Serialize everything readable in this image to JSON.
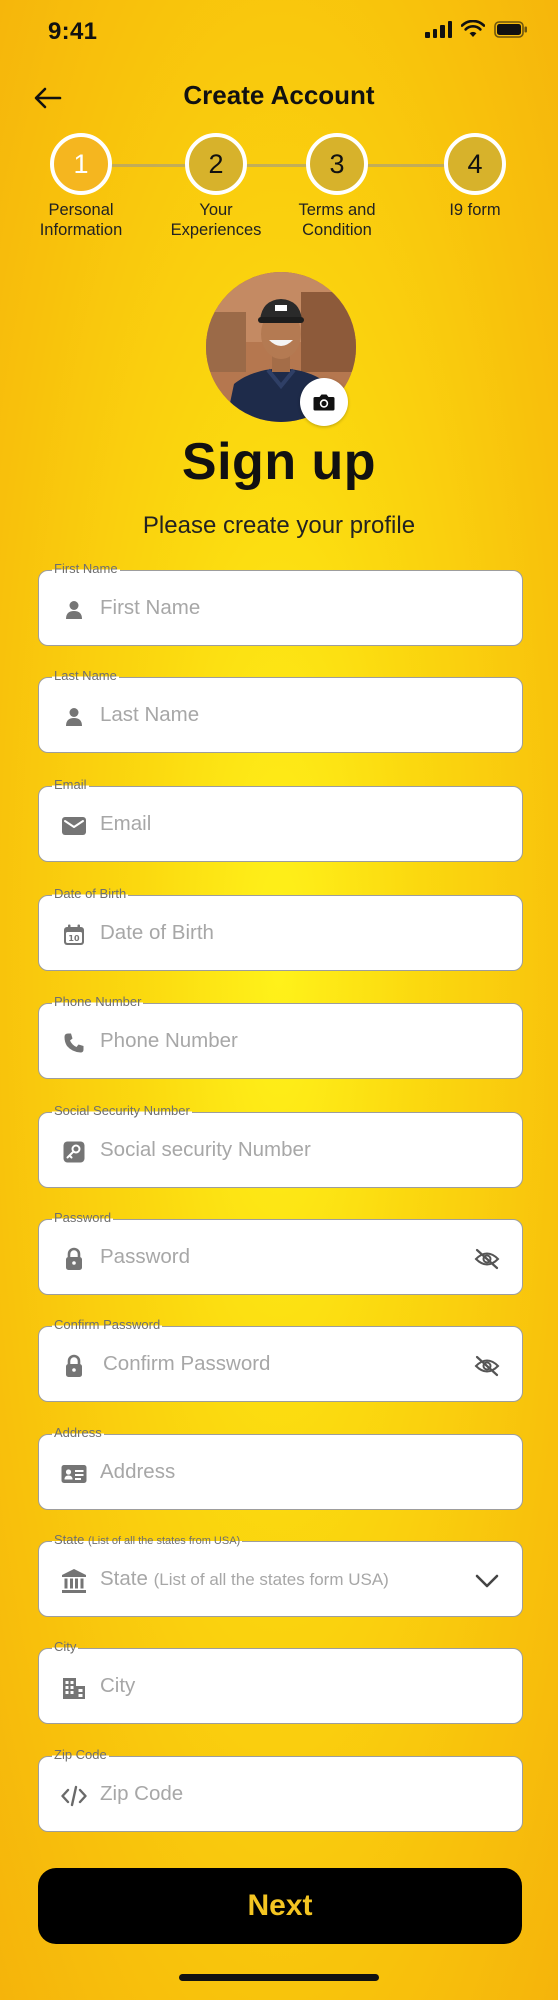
{
  "status_bar": {
    "time": "9:41"
  },
  "header": {
    "title": "Create Account"
  },
  "stepper": {
    "active_step": 1,
    "steps": [
      {
        "number": "1",
        "label_line1": "Personal",
        "label_line2": "Information"
      },
      {
        "number": "2",
        "label_line1": "Your",
        "label_line2": "Experiences"
      },
      {
        "number": "3",
        "label_line1": "Terms and",
        "label_line2": "Condition"
      },
      {
        "number": "4",
        "label_line1": "I9 form",
        "label_line2": ""
      }
    ]
  },
  "heading": {
    "title": "Sign up",
    "subtitle": "Please create your profile"
  },
  "fields": {
    "first_name": {
      "label": "First Name",
      "placeholder": "First Name",
      "icon": "person-icon"
    },
    "last_name": {
      "label": "Last Name",
      "placeholder": "Last Name",
      "icon": "person-icon"
    },
    "email": {
      "label": "Email",
      "placeholder": "Email",
      "icon": "envelope-icon"
    },
    "dob": {
      "label": "Date of Birth",
      "placeholder": "Date of Birth",
      "icon": "calendar-icon"
    },
    "phone": {
      "label": "Phone Number",
      "placeholder": "Phone Number",
      "icon": "phone-icon"
    },
    "ssn": {
      "label": "Social Security Number",
      "placeholder": "Social security Number",
      "icon": "ssn-icon"
    },
    "password": {
      "label": "Password",
      "placeholder": "Password",
      "icon": "lock-icon"
    },
    "confirm_password": {
      "label": "Confirm Password",
      "placeholder": "Confirm Password",
      "icon": "lock-icon"
    },
    "address": {
      "label": "Address",
      "placeholder": "Address",
      "icon": "id-card-icon"
    },
    "state": {
      "label": "State",
      "label_hint": "(List of all the states from USA)",
      "placeholder": "State",
      "placeholder_hint": "(List of all the states form USA)",
      "icon": "bank-icon"
    },
    "city": {
      "label": "City",
      "placeholder": "City",
      "icon": "city-icon"
    },
    "zip": {
      "label": "Zip Code",
      "placeholder": "Zip Code",
      "icon": "code-icon"
    }
  },
  "next_button": {
    "label": "Next"
  },
  "colors": {
    "background": "#fbd90f",
    "active_step": "#f5b61f",
    "inactive_step": "#d7b22b",
    "button_bg": "#000000",
    "button_text": "#f4c522",
    "placeholder": "#a7a7a7"
  }
}
